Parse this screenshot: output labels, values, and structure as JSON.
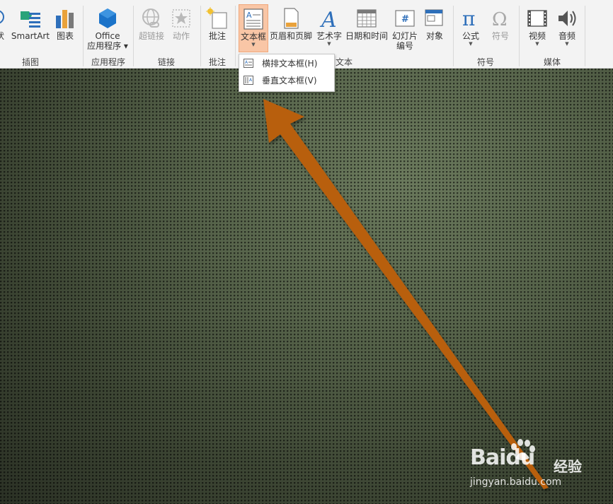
{
  "ribbon": {
    "buttons": {
      "shapes_partial": "状",
      "smartart": "SmartArt",
      "chart": "图表",
      "office_line1": "Office",
      "office_line2": "应用程序",
      "hyperlink": "超链接",
      "action": "动作",
      "comment": "批注",
      "textbox": "文本框",
      "header_footer": "页眉和页脚",
      "wordart": "艺术字",
      "datetime": "日期和时间",
      "slide_number_line1": "幻灯片",
      "slide_number_line2": "编号",
      "object": "对象",
      "equation": "公式",
      "symbol": "符号",
      "video": "视频",
      "audio": "音频"
    },
    "groups": {
      "illustrations": "插图",
      "apps": "应用程序",
      "links": "链接",
      "comments": "批注",
      "text": "文本",
      "symbols": "符号",
      "media": "媒体"
    }
  },
  "dropdown": {
    "items": [
      {
        "label": "横排文本框(H)"
      },
      {
        "label": "垂直文本框(V)"
      }
    ]
  },
  "watermark": {
    "brand": "Baidu",
    "suffix": "经验",
    "url": "jingyan.baidu.com"
  },
  "colors": {
    "arrow": "#b85f0c",
    "active_button": "#f9c6a6",
    "icon_blue": "#2e6fba"
  }
}
